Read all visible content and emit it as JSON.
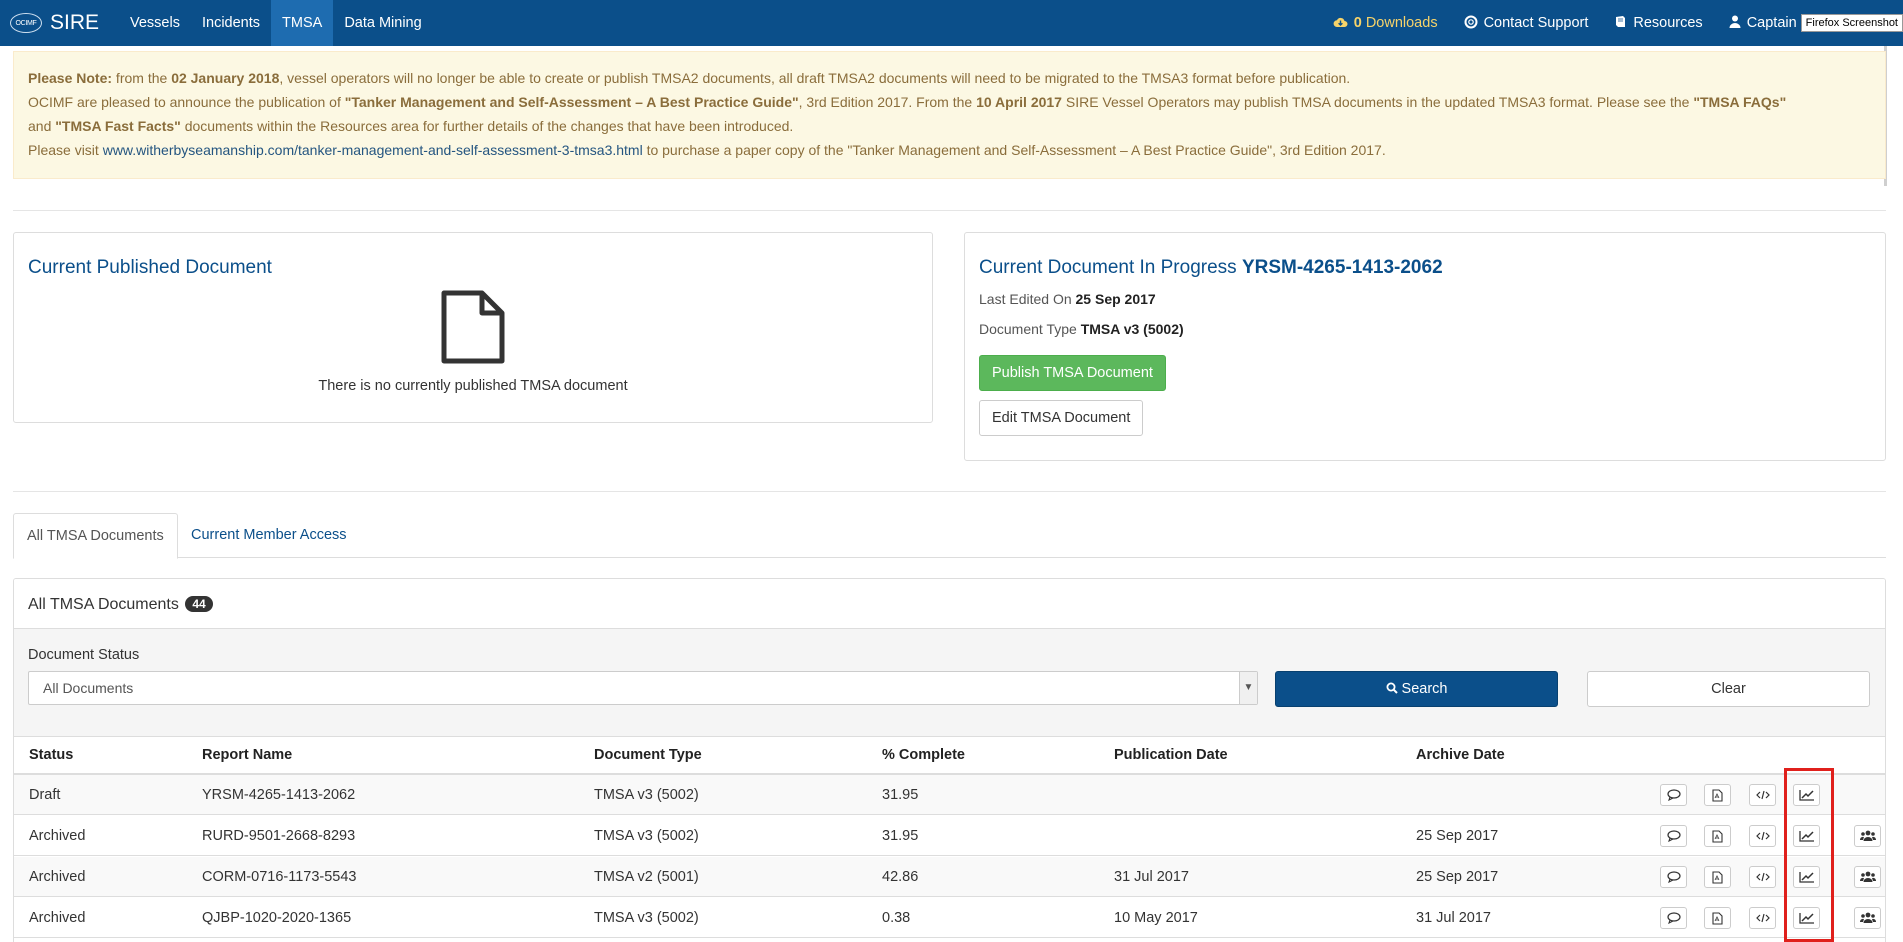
{
  "navbar": {
    "logo": "OCIMF",
    "brand": "SIRE",
    "items": [
      {
        "label": "Vessels",
        "active": false
      },
      {
        "label": "Incidents",
        "active": false
      },
      {
        "label": "TMSA",
        "active": true
      },
      {
        "label": "Data Mining",
        "active": false
      }
    ],
    "downloads_count": "0",
    "downloads_label": "Downloads",
    "contact_support": "Contact Support",
    "resources": "Resources",
    "user": "Captain",
    "firefox_tooltip": "Firefox Screenshot"
  },
  "alert": {
    "line1": {
      "prefix": "Please Note:",
      "text_a": " from the ",
      "date": "02 January 2018",
      "text_b": ", vessel operators will no longer be able to create or publish TMSA2 documents, all draft TMSA2 documents will need to be migrated to the TMSA3 format before publication."
    },
    "line2": {
      "text_a": "OCIMF are pleased to announce the publication of ",
      "guide": "\"Tanker Management and Self-Assessment – A Best Practice Guide\"",
      "text_b": ", 3rd Edition 2017. From the ",
      "date": "10 April 2017",
      "text_c": " SIRE Vessel Operators may publish TMSA documents in the updated TMSA3 format. Please see the ",
      "faqs": "\"TMSA FAQs\""
    },
    "line3": {
      "text_a": "and ",
      "fast_facts": "\"TMSA Fast Facts\"",
      "text_b": " documents within the Resources area for further details of the changes that have been introduced."
    },
    "line4": {
      "text_a": "Please visit ",
      "link": "www.witherbyseamanship.com/tanker-management-and-self-assessment-3-tmsa3.html",
      "text_b": " to purchase a paper copy of the \"Tanker Management and Self-Assessment – A Best Practice Guide\", 3rd Edition 2017."
    }
  },
  "published_panel": {
    "title": "Current Published Document",
    "empty_message": "There is no currently published TMSA document"
  },
  "progress_panel": {
    "title_prefix": "Current Document In Progress",
    "doc_id": "YRSM-4265-1413-2062",
    "last_edited_label": "Last Edited On",
    "last_edited_value": "25 Sep 2017",
    "doc_type_label": "Document Type",
    "doc_type_value": "TMSA v3 (5002)",
    "publish_button": "Publish TMSA Document",
    "edit_button": "Edit TMSA Document"
  },
  "tabs": [
    {
      "label": "All TMSA Documents",
      "active": true
    },
    {
      "label": "Current Member Access",
      "active": false
    }
  ],
  "list": {
    "title": "All TMSA Documents",
    "count": "44",
    "filter_label": "Document Status",
    "filter_value": "All Documents",
    "search_button": "Search",
    "clear_button": "Clear",
    "columns": [
      "Status",
      "Report Name",
      "Document Type",
      "% Complete",
      "Publication Date",
      "Archive Date"
    ],
    "rows": [
      {
        "status": "Draft",
        "report": "YRSM-4265-1413-2062",
        "type": "TMSA v3 (5002)",
        "complete": "31.95",
        "published": "",
        "archived": "",
        "has_access_button": false
      },
      {
        "status": "Archived",
        "report": "RURD-9501-2668-8293",
        "type": "TMSA v3 (5002)",
        "complete": "31.95",
        "published": "",
        "archived": "25 Sep 2017",
        "has_access_button": true
      },
      {
        "status": "Archived",
        "report": "CORM-0716-1173-5543",
        "type": "TMSA v2 (5001)",
        "complete": "42.86",
        "published": "31 Jul 2017",
        "archived": "25 Sep 2017",
        "has_access_button": true
      },
      {
        "status": "Archived",
        "report": "QJBP-1020-2020-1365",
        "type": "TMSA v3 (5002)",
        "complete": "0.38",
        "published": "10 May 2017",
        "archived": "31 Jul 2017",
        "has_access_button": true
      }
    ]
  },
  "colors": {
    "navbar": "#0b4f8a",
    "navbar_active": "#1e6cb0",
    "alert_bg": "#fcf8e3",
    "alert_text": "#8a6d3b",
    "success": "#5cb85c",
    "primary": "#0b4f8a",
    "highlight": "#e0201c"
  }
}
